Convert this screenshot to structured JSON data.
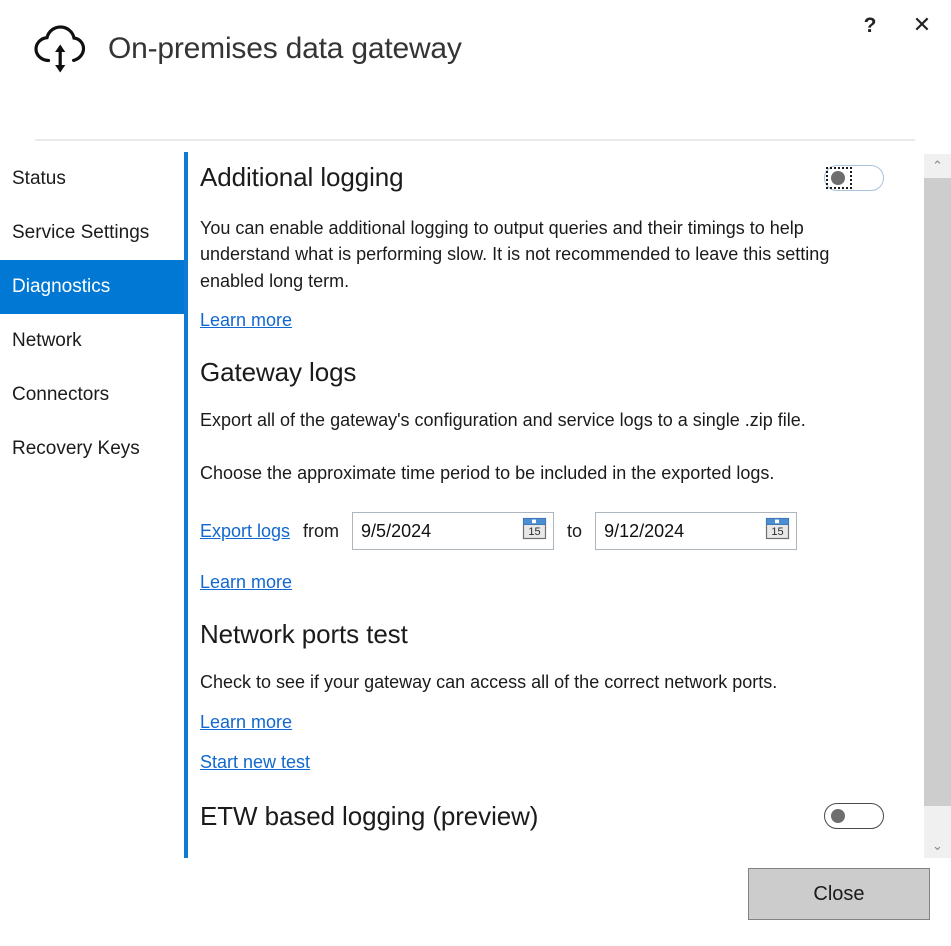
{
  "window": {
    "title": "On-premises data gateway",
    "icon": "cloud-upload-download-icon",
    "help_label": "?",
    "close_label": "✕"
  },
  "sidebar": {
    "items": [
      {
        "label": "Status",
        "selected": false
      },
      {
        "label": "Service Settings",
        "selected": false
      },
      {
        "label": "Diagnostics",
        "selected": true
      },
      {
        "label": "Network",
        "selected": false
      },
      {
        "label": "Connectors",
        "selected": false
      },
      {
        "label": "Recovery Keys",
        "selected": false
      }
    ]
  },
  "content": {
    "additional_logging": {
      "heading": "Additional logging",
      "description": "You can enable additional logging to output queries and their timings to help understand what is performing slow. It is not recommended to leave this setting enabled long term.",
      "learn_more": "Learn more",
      "toggle_state": "off"
    },
    "gateway_logs": {
      "heading": "Gateway logs",
      "description": "Export all of the gateway's configuration and service logs to a single .zip file.",
      "instruction": "Choose the approximate time period to be included in the exported logs.",
      "export_link": "Export logs",
      "from_label": "from",
      "from_date": "9/5/2024",
      "to_label": "to",
      "to_date": "9/12/2024",
      "calendar_day": "15",
      "learn_more": "Learn more"
    },
    "network_ports_test": {
      "heading": "Network ports test",
      "description": "Check to see if your gateway can access all of the correct network ports.",
      "learn_more": "Learn more",
      "start_new_test": "Start new test"
    },
    "etw_logging": {
      "heading": "ETW based logging (preview)",
      "toggle_state": "off"
    }
  },
  "scrollbar": {
    "up_arrow": "⌃",
    "down_arrow": "⌄"
  },
  "footer": {
    "close_label": "Close"
  },
  "colors": {
    "accent": "#0078d4",
    "link": "#1168cf",
    "text": "#1b1b1b",
    "title": "#343434",
    "button_face": "#cccccc"
  }
}
